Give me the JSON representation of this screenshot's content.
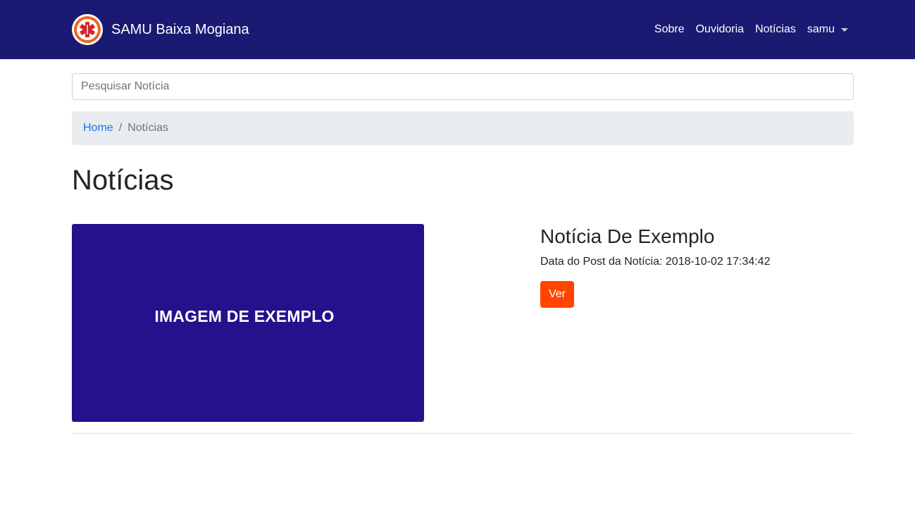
{
  "navbar": {
    "brand": "SAMU Baixa Mogiana",
    "logo_icon": "samu-star-of-life-icon",
    "background": "#1a1a72",
    "links": [
      "Sobre",
      "Ouvidoria",
      "Notícias"
    ],
    "user_menu": "samu"
  },
  "search": {
    "placeholder": "Pesquisar Notícia",
    "value": ""
  },
  "breadcrumb": {
    "home": "Home",
    "separator": "/",
    "current": "Notícias"
  },
  "page": {
    "title": "Notícias"
  },
  "news": {
    "image_text": "IMAGEM DE EXEMPLO",
    "title": "Notícia De Exemplo",
    "date_label": "Data do Post da Notícia:",
    "date_value": "2018-10-02 17:34:42",
    "button_label": "Ver",
    "button_color": "#ff4500",
    "image_color": "#23128c"
  }
}
